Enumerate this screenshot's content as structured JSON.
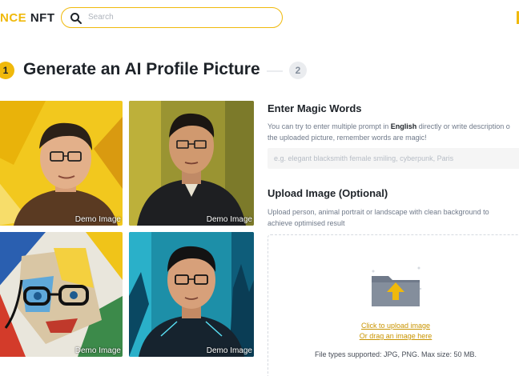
{
  "header": {
    "logo_brand": "NCE",
    "logo_suffix": "NFT",
    "search_placeholder": "Search"
  },
  "stepper": {
    "step1_number": "1",
    "title": "Generate an AI Profile Picture",
    "step2_number": "2"
  },
  "demo_images": [
    {
      "caption": "Demo Image"
    },
    {
      "caption": "Demo Image"
    },
    {
      "caption": "Demo Image"
    },
    {
      "caption": "Demo Image"
    }
  ],
  "magic_words": {
    "title": "Enter Magic Words",
    "desc_part1": "You can try to enter multiple prompt in ",
    "desc_bold": "English",
    "desc_part2": " directly or write description o",
    "desc_line2": "the uploaded picture, remember words are magic!",
    "input_placeholder": "e.g. elegant blacksmith female smiling, cyberpunk, Paris",
    "input_value": ""
  },
  "upload": {
    "title": "Upload Image (Optional)",
    "desc_line1": "Upload person, animal portrait or landscape with clean background to",
    "desc_line2": "achieve optimised result",
    "click_link": "Click to upload image",
    "drag_link": "Or drag an image here",
    "file_types": "File types supported: JPG, PNG. Max size: 50 MB."
  },
  "colors": {
    "accent": "#f0b90b",
    "link": "#c99400",
    "folder": "#707a8a"
  }
}
